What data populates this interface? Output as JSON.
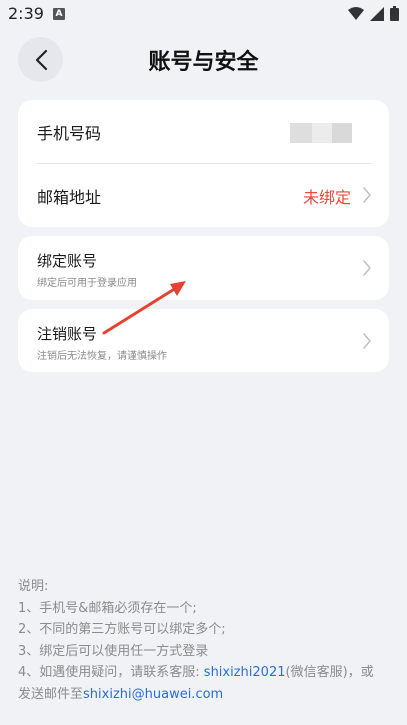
{
  "status_bar": {
    "time": "2:39",
    "app_badge": "A"
  },
  "header": {
    "title": "账号与安全"
  },
  "account_card": {
    "phone_label": "手机号码",
    "email_label": "邮箱地址",
    "email_status": "未绑定",
    "email_status_color": "#e84a3a"
  },
  "bind_card": {
    "title": "绑定账号",
    "subtitle": "绑定后可用于登录应用"
  },
  "cancel_card": {
    "title": "注销账号",
    "subtitle": "注销后无法恢复，请谨慎操作"
  },
  "notes": {
    "heading": "说明:",
    "line1": "1、手机号&邮箱必须存在一个;",
    "line2": "2、不同的第三方账号可以绑定多个;",
    "line3": "3、绑定后可以使用任一方式登录",
    "line4_prefix": "4、如遇使用疑问，请联系客服: ",
    "wechat_id": "shixizhi2021",
    "line4_suffix": "(微信客服)，或",
    "line5_prefix": "发送邮件至",
    "email": "shixizhi@huawei.com",
    "link_color": "#2a6ed9"
  },
  "icons": [
    "back-arrow-icon",
    "chevron-right-icon",
    "wifi-icon",
    "signal-icon",
    "battery-icon"
  ]
}
